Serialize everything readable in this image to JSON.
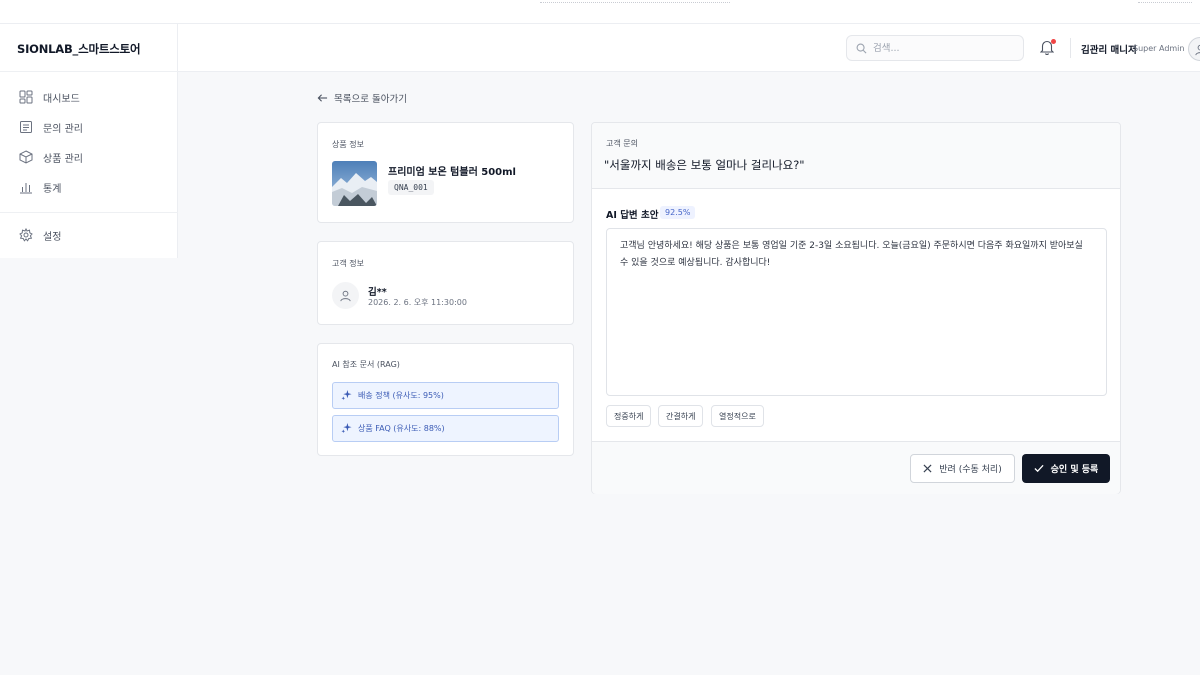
{
  "brand": {
    "title": "SIONLAB_스마트스토어"
  },
  "sidebar": {
    "items": [
      {
        "label": "대시보드",
        "icon": "dashboard-icon"
      },
      {
        "label": "문의 관리",
        "icon": "inquiry-icon"
      },
      {
        "label": "상품 관리",
        "icon": "box-icon"
      },
      {
        "label": "통계",
        "icon": "chart-icon"
      },
      {
        "label": "설정",
        "icon": "gear-icon"
      }
    ]
  },
  "header": {
    "search_placeholder": "검색...",
    "user_name": "김관리 매니저",
    "user_role": "Super Admin",
    "notification_dot_color": "#ef4444"
  },
  "back_link": "목록으로 돌아가기",
  "product": {
    "section_label": "상품 정보",
    "name": "프리미엄 보온 텀블러 500ml",
    "code": "QNA_001"
  },
  "customer": {
    "section_label": "고객 정보",
    "name": "김**",
    "timestamp": "2026. 2. 6. 오후 11:30:00"
  },
  "rag": {
    "section_label": "AI 참조 문서 (RAG)",
    "items": [
      {
        "label": "배송 정책 (유사도: 95%)"
      },
      {
        "label": "상품 FAQ (유사도: 88%)"
      }
    ]
  },
  "inquiry": {
    "section_label": "고객 문의",
    "question": "\"서울까지 배송은 보통 얼마나 걸리나요?\""
  },
  "ai_draft": {
    "title": "AI 답변 초안",
    "confidence": "92.5%",
    "answer": "고객님 안녕하세요! 해당 상품은 보통 영업일 기준 2-3일 소요됩니다. 오늘(금요일) 주문하시면 다음주 화요일까지 받아보실 수 있을 것으로 예상됩니다. 감사합니다!",
    "tone_buttons": [
      "정중하게",
      "간결하게",
      "열정적으로"
    ]
  },
  "actions": {
    "reject_label": "반려 (수동 처리)",
    "approve_label": "승인 및 등록"
  },
  "colors": {
    "accent_dark": "#111827",
    "rag_blue": "#3b5bb5",
    "badge_blue": "#4766c9"
  }
}
